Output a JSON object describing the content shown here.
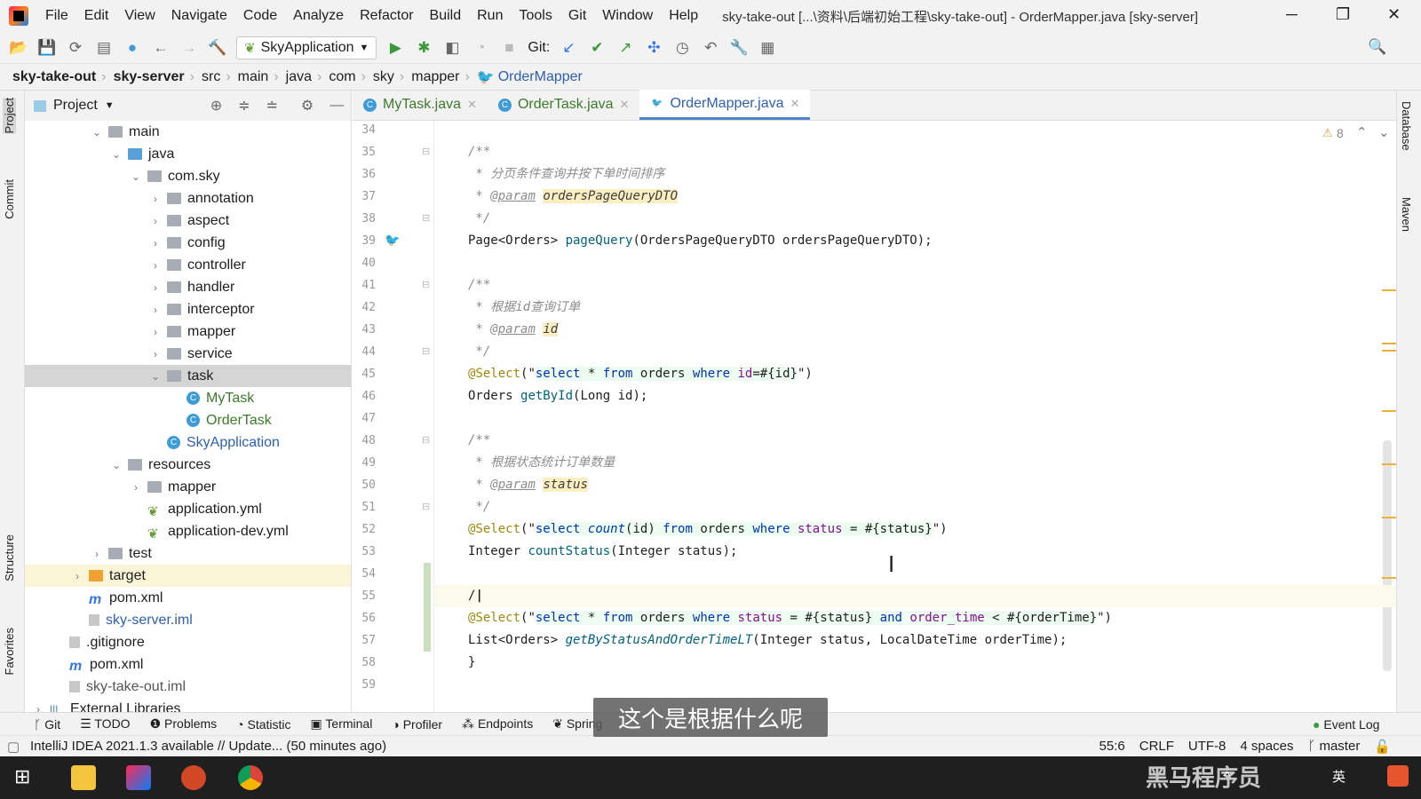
{
  "window": {
    "title": "sky-take-out [...\\资料\\后端初始工程\\sky-take-out] - OrderMapper.java [sky-server]",
    "minimize": "─",
    "restore": "❐",
    "close": "✕"
  },
  "menu": [
    "File",
    "Edit",
    "View",
    "Navigate",
    "Code",
    "Analyze",
    "Refactor",
    "Build",
    "Run",
    "Tools",
    "Git",
    "Window",
    "Help"
  ],
  "toolbar": {
    "run_config": "SkyApplication",
    "git_label": "Git:"
  },
  "breadcrumb": [
    "sky-take-out",
    "sky-server",
    "src",
    "main",
    "java",
    "com",
    "sky",
    "mapper",
    "OrderMapper"
  ],
  "left_tool_tabs": [
    "Project",
    "Commit",
    "Structure",
    "Favorites"
  ],
  "right_tool_tabs": [
    "Database",
    "Maven"
  ],
  "project": {
    "title": "Project",
    "tree": [
      {
        "label": "main",
        "depth": 3,
        "icon": "folder",
        "expanded": true
      },
      {
        "label": "java",
        "depth": 4,
        "icon": "folder-blue",
        "expanded": true
      },
      {
        "label": "com.sky",
        "depth": 5,
        "icon": "folder",
        "expanded": true
      },
      {
        "label": "annotation",
        "depth": 6,
        "icon": "folder",
        "expanded": false
      },
      {
        "label": "aspect",
        "depth": 6,
        "icon": "folder",
        "expanded": false
      },
      {
        "label": "config",
        "depth": 6,
        "icon": "folder",
        "expanded": false
      },
      {
        "label": "controller",
        "depth": 6,
        "icon": "folder",
        "expanded": false
      },
      {
        "label": "handler",
        "depth": 6,
        "icon": "folder",
        "expanded": false
      },
      {
        "label": "interceptor",
        "depth": 6,
        "icon": "folder",
        "expanded": false
      },
      {
        "label": "mapper",
        "depth": 6,
        "icon": "folder",
        "expanded": false
      },
      {
        "label": "service",
        "depth": 6,
        "icon": "folder",
        "expanded": false
      },
      {
        "label": "task",
        "depth": 6,
        "icon": "folder",
        "expanded": true,
        "selected": true
      },
      {
        "label": "MyTask",
        "depth": 7,
        "icon": "class",
        "color": "#3d7a2a"
      },
      {
        "label": "OrderTask",
        "depth": 7,
        "icon": "class",
        "color": "#3d7a2a"
      },
      {
        "label": "SkyApplication",
        "depth": 6,
        "icon": "class",
        "color": "#2f5fb3"
      },
      {
        "label": "resources",
        "depth": 4,
        "icon": "folder",
        "expanded": true
      },
      {
        "label": "mapper",
        "depth": 5,
        "icon": "folder",
        "expanded": false
      },
      {
        "label": "application.yml",
        "depth": 5,
        "icon": "spring"
      },
      {
        "label": "application-dev.yml",
        "depth": 5,
        "icon": "spring"
      },
      {
        "label": "test",
        "depth": 3,
        "icon": "folder",
        "expanded": false
      },
      {
        "label": "target",
        "depth": 2,
        "icon": "folder-orange",
        "expanded": false,
        "target": true
      },
      {
        "label": "pom.xml",
        "depth": 2,
        "icon": "maven"
      },
      {
        "label": "sky-server.iml",
        "depth": 2,
        "icon": "file",
        "color": "#2f5fb3"
      },
      {
        "label": ".gitignore",
        "depth": 1,
        "icon": "file"
      },
      {
        "label": "pom.xml",
        "depth": 1,
        "icon": "maven"
      },
      {
        "label": "sky-take-out.iml",
        "depth": 1,
        "icon": "file",
        "color": "#555"
      },
      {
        "label": "External Libraries",
        "depth": 0,
        "icon": "libs",
        "expanded": false
      }
    ]
  },
  "tabs": [
    {
      "label": "MyTask.java",
      "color": "#3d7a2a"
    },
    {
      "label": "OrderTask.java",
      "color": "#3d7a2a"
    },
    {
      "label": "OrderMapper.java",
      "color": "#2f5fb3",
      "active": true
    }
  ],
  "editor": {
    "warnings": "8",
    "first_line": 34,
    "lines": [
      [],
      [
        [
          "/**",
          "cm"
        ]
      ],
      [
        [
          " * 分页条件查询并按下单时间排序",
          "cm"
        ]
      ],
      [
        [
          " * ",
          "cm"
        ],
        [
          "@param",
          "tag"
        ],
        [
          " ",
          ""
        ],
        [
          "ordersPageQueryDTO",
          "pv"
        ]
      ],
      [
        [
          " */",
          "cm"
        ]
      ],
      [
        [
          "Page<Orders> ",
          ""
        ],
        [
          "pageQuery",
          "fn"
        ],
        [
          "(OrdersPageQueryDTO ordersPageQueryDTO);",
          ""
        ]
      ],
      [],
      [
        [
          "/**",
          "cm"
        ]
      ],
      [
        [
          " * 根据id查询订单",
          "cm"
        ]
      ],
      [
        [
          " * ",
          "cm"
        ],
        [
          "@param",
          "tag"
        ],
        [
          " ",
          ""
        ],
        [
          "id",
          "pv"
        ]
      ],
      [
        [
          " */",
          "cm"
        ]
      ],
      [
        [
          "@Select",
          "an"
        ],
        [
          "(\"",
          ""
        ],
        [
          "select",
          "kw"
        ],
        [
          " * ",
          "pl"
        ],
        [
          "from",
          "kw"
        ],
        [
          " orders ",
          "pl"
        ],
        [
          "where",
          "kw"
        ],
        [
          " ",
          "pl"
        ],
        [
          "id",
          "id"
        ],
        [
          "=#{id}",
          "pl"
        ],
        [
          "\")",
          ""
        ]
      ],
      [
        [
          "Orders ",
          ""
        ],
        [
          "getById",
          "fn"
        ],
        [
          "(Long id);",
          ""
        ]
      ],
      [],
      [
        [
          "/**",
          "cm"
        ]
      ],
      [
        [
          " * 根据状态统计订单数量",
          "cm"
        ]
      ],
      [
        [
          " * ",
          "cm"
        ],
        [
          "@param",
          "tag"
        ],
        [
          " ",
          ""
        ],
        [
          "status",
          "pv"
        ]
      ],
      [
        [
          " */",
          "cm"
        ]
      ],
      [
        [
          "@Select",
          "an"
        ],
        [
          "(\"",
          ""
        ],
        [
          "select",
          "kw"
        ],
        [
          " ",
          "pl"
        ],
        [
          "count",
          "sqlf"
        ],
        [
          "(id) ",
          "pl"
        ],
        [
          "from",
          "kw"
        ],
        [
          " orders ",
          "pl"
        ],
        [
          "where",
          "kw"
        ],
        [
          " ",
          "pl"
        ],
        [
          "status",
          "id"
        ],
        [
          " = #{status}",
          "pl"
        ],
        [
          "\")",
          ""
        ]
      ],
      [
        [
          "Integer ",
          ""
        ],
        [
          "countStatus",
          "fn"
        ],
        [
          "(Integer status);",
          ""
        ]
      ],
      [],
      [
        [
          "/",
          ""
        ]
      ],
      [
        [
          "@Select",
          "an"
        ],
        [
          "(\"",
          ""
        ],
        [
          "select",
          "kw"
        ],
        [
          " * ",
          "pl"
        ],
        [
          "from",
          "kw"
        ],
        [
          " orders ",
          "pl"
        ],
        [
          "where",
          "kw"
        ],
        [
          " ",
          "pl"
        ],
        [
          "status",
          "id"
        ],
        [
          " = #{status} ",
          "pl"
        ],
        [
          "and",
          "kw"
        ],
        [
          " ",
          "pl"
        ],
        [
          "order_time",
          "id"
        ],
        [
          " < #{orderTime}",
          "pl"
        ],
        [
          "\")",
          ""
        ]
      ],
      [
        [
          "List<Orders> ",
          ""
        ],
        [
          "getByStatusAndOrderTimeLT",
          "fni"
        ],
        [
          "(Integer status, LocalDateTime orderTime);",
          ""
        ]
      ],
      [
        [
          "}",
          ""
        ]
      ],
      []
    ]
  },
  "bottom_tabs": [
    "Git",
    "TODO",
    "Problems",
    "Statistic",
    "Terminal",
    "Profiler",
    "Endpoints",
    "Spring",
    "Event Log"
  ],
  "status": {
    "message": "IntelliJ IDEA 2021.1.3 available // Update... (50 minutes ago)",
    "position": "55:6",
    "line_sep": "CRLF",
    "encoding": "UTF-8",
    "indent": "4 spaces",
    "branch": "master"
  },
  "subtitle": "这个是根据什么呢",
  "watermark": "黑马程序员",
  "colors": {
    "accent": "#4a88c7",
    "chrome": "#f2f2f2",
    "taskbar": "#1f1f1f"
  }
}
